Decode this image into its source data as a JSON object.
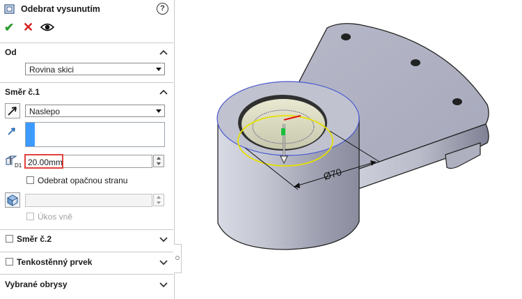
{
  "panel": {
    "title": "Odebrat vysunutím",
    "help_icon": "help-icon",
    "actions": {
      "ok": "confirm-icon",
      "cancel": "cancel-icon",
      "preview": "eye-icon"
    }
  },
  "from_section": {
    "header": "Od",
    "selected": "Rovina skici"
  },
  "direction1": {
    "header": "Směr č.1",
    "end_condition": "Naslepo",
    "depth": "20.00mm",
    "flip_side_label": "Odebrat opačnou stranu",
    "flip_side_checked": false,
    "draft_outward_label": "Úkos vně",
    "draft_outward_checked": false
  },
  "direction2": {
    "header": "Směr č.2",
    "checked": false
  },
  "thin_feature": {
    "header": "Tenkostěnný prvek",
    "checked": false
  },
  "selected_contours": {
    "header": "Vybrané obrysy"
  },
  "viewport": {
    "dimension_label": "Ø70",
    "colors": {
      "body": "#b9bccb",
      "highlight_yellow": "#e6e000",
      "sketch_blue": "#4050d0"
    }
  }
}
